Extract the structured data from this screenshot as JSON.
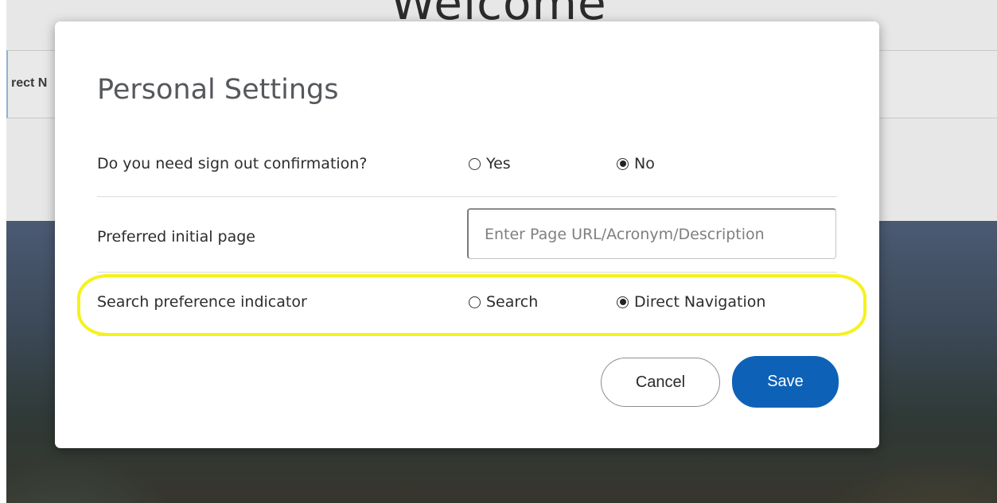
{
  "background": {
    "welcome_text": "Welcome",
    "nav_partial_text": "rect N"
  },
  "modal": {
    "title": "Personal Settings",
    "signout": {
      "label": "Do you need sign out confirmation?",
      "options": [
        {
          "label": "Yes",
          "checked": false
        },
        {
          "label": "No",
          "checked": true
        }
      ]
    },
    "initial_page": {
      "label": "Preferred initial page",
      "value": "",
      "placeholder": "Enter Page URL/Acronym/Description"
    },
    "search_preference": {
      "label": "Search preference indicator",
      "options": [
        {
          "label": "Search",
          "checked": false
        },
        {
          "label": "Direct Navigation",
          "checked": true
        }
      ]
    },
    "buttons": {
      "cancel": "Cancel",
      "save": "Save"
    }
  },
  "colors": {
    "save_button": "#0d62b7",
    "highlight": "#f5f21c"
  }
}
